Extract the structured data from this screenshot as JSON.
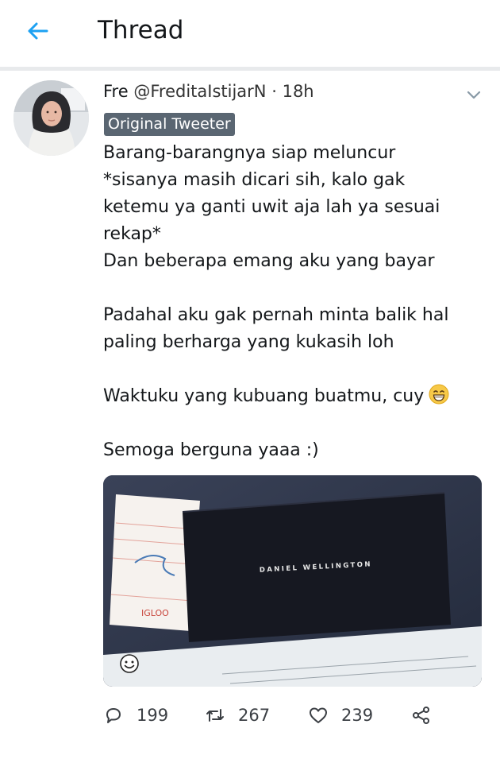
{
  "header": {
    "title": "Thread"
  },
  "tweet": {
    "author_name": "Fre",
    "author_handle": "@FreditaIstijarN",
    "separator": "·",
    "time": "18h",
    "badge": "Original Tweeter",
    "lines": [
      "Barang-barangnya siap meluncur",
      "*sisanya masih dicari sih, kalo gak",
      "ketemu ya ganti uwit aja lah ya sesuai",
      "rekap*",
      "Dan beberapa emang aku yang bayar",
      "",
      "Padahal aku gak pernah minta balik hal",
      "paling berharga yang kukasih loh",
      "",
      "Waktuku yang kubuang buatmu, cuy",
      "",
      "Semoga berguna yaaa :)"
    ],
    "emoji": "grinning-face-with-smiling-eyes",
    "media": {
      "box_text": "DANIEL WELLINGTON",
      "receipt_text": "IGLOO"
    },
    "actions": {
      "replies": "199",
      "retweets": "267",
      "likes": "239"
    }
  },
  "colors": {
    "accent": "#1da1f2",
    "badge_bg": "#5a6672",
    "text": "#14171a",
    "muted": "#657786"
  }
}
